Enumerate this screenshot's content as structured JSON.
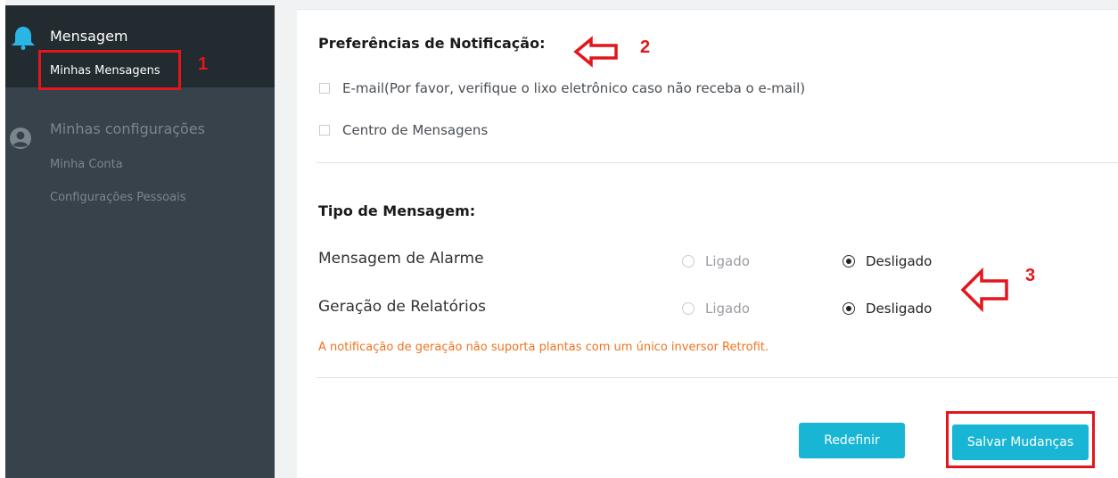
{
  "sidebar": {
    "group_message": "Mensagem",
    "item_my_messages": "Minhas Mensagens",
    "group_settings": "Minhas configurações",
    "item_my_account": "Minha Conta",
    "item_personal_settings": "Configurações Pessoais"
  },
  "notification_prefs": {
    "title": "Preferências de Notificação:",
    "email_label": "E-mail(Por favor, verifique o lixo eletrônico caso não receba o e-mail)",
    "message_center_label": "Centro de Mensagens"
  },
  "message_type": {
    "title": "Tipo de Mensagem:",
    "rows": [
      {
        "label": "Mensagem de Alarme",
        "on_label": "Ligado",
        "off_label": "Desligado",
        "selected": "off"
      },
      {
        "label": "Geração de Relatórios",
        "on_label": "Ligado",
        "off_label": "Desligado",
        "selected": "off"
      }
    ],
    "note": "A notificação de geração não suporta plantas com um único inversor Retrofit."
  },
  "buttons": {
    "reset": "Redefinir",
    "save": "Salvar Mudanças"
  },
  "annotations": {
    "step1": "1",
    "step2": "2",
    "step3": "3"
  },
  "colors": {
    "accent": "#19b5d4",
    "sidebar_bg": "#37424a",
    "sidebar_active_bg": "#222b30",
    "warning_text": "#f0731f",
    "annotation_red": "#e2161c"
  },
  "icons": {
    "message_group": "bell-icon",
    "settings_group": "user-circle-icon",
    "annotation_arrow": "left-arrow-icon"
  }
}
